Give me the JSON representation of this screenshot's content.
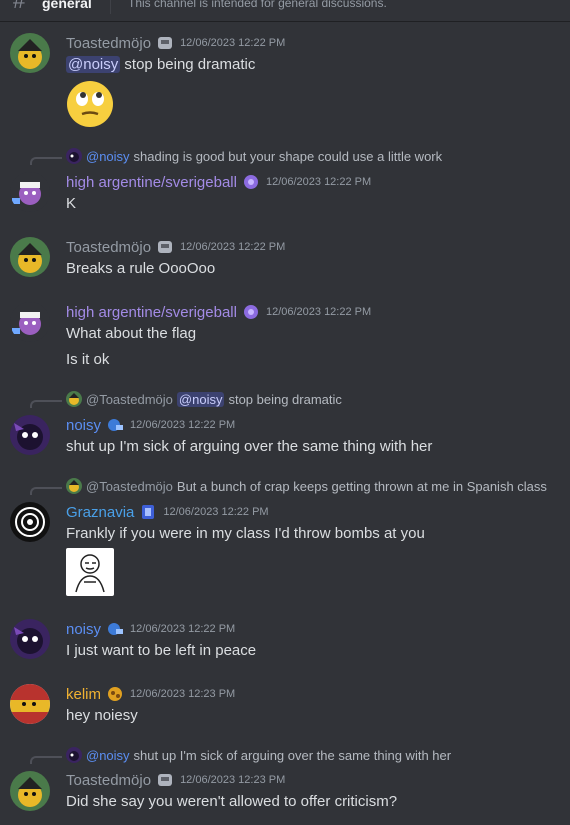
{
  "channel": {
    "name": "general",
    "topic": "This channel is intended for general discussions."
  },
  "colors": {
    "toasted": "#949ba4",
    "argentine": "#a38be6",
    "noisy": "#5b8ef2",
    "graznavia": "#4aa0e8",
    "kelim": "#f0b232",
    "mention_bg": "#3c4270"
  },
  "messages": [
    {
      "author": "Toastedmöjo",
      "timestamp": "12/06/2023 12:22 PM",
      "mention": "@noisy",
      "text": "stop being dramatic",
      "attachment": "face-with-rolling-eyes-emoji"
    },
    {
      "reply": {
        "author": "@noisy",
        "text": "shading is good but your shape could use a little work"
      },
      "author": "high argentine/sverigeball",
      "timestamp": "12/06/2023 12:22 PM",
      "text": "K"
    },
    {
      "author": "Toastedmöjo",
      "timestamp": "12/06/2023 12:22 PM",
      "text": "Breaks a rule OooOoo"
    },
    {
      "author": "high argentine/sverigeball",
      "timestamp": "12/06/2023 12:22 PM",
      "lines": [
        "What about the flag",
        "Is it ok"
      ]
    },
    {
      "reply": {
        "author": "@Toastedmöjo",
        "mention": "@noisy",
        "text": "stop being dramatic"
      },
      "author": "noisy",
      "timestamp": "12/06/2023 12:22 PM",
      "text": "shut up I'm sick of arguing over the same thing with her"
    },
    {
      "reply": {
        "author": "@Toastedmöjo",
        "text": "But a bunch of crap keeps getting thrown at me in Spanish class"
      },
      "author": "Graznavia",
      "timestamp": "12/06/2023 12:22 PM",
      "text": "Frankly if you were in my class I'd throw bombs at you",
      "attachment": "meme-face-image"
    },
    {
      "author": "noisy",
      "timestamp": "12/06/2023 12:22 PM",
      "text": "I just want to be left in peace"
    },
    {
      "author": "kelim",
      "timestamp": "12/06/2023 12:23 PM",
      "text": "hey noiesy"
    },
    {
      "reply": {
        "author": "@noisy",
        "text": "shut up I'm sick of arguing over the same thing with her"
      },
      "author": "Toastedmöjo",
      "timestamp": "12/06/2023 12:23 PM",
      "text": "Did she say you weren't allowed to offer criticism?"
    }
  ]
}
